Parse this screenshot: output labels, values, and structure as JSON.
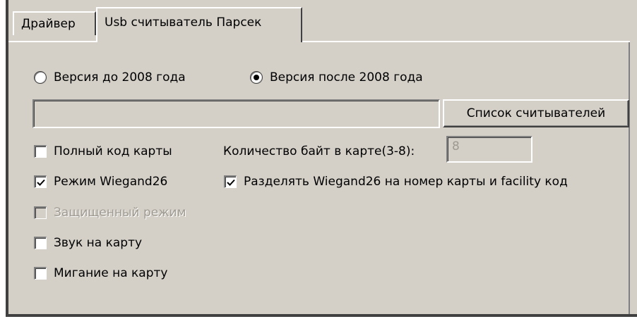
{
  "tabs": [
    {
      "label": "Драйвер",
      "active": false
    },
    {
      "label": "Usb считыватель Парсек",
      "active": true
    }
  ],
  "version": {
    "options": [
      {
        "label": "Версия до 2008 года",
        "selected": false
      },
      {
        "label": "Версия после 2008 года",
        "selected": true
      }
    ]
  },
  "reader": {
    "path_value": "",
    "list_button_label": "Список считывателей"
  },
  "options": {
    "full_code": {
      "label": "Полный код карты",
      "checked": false
    },
    "wiegand26": {
      "label": "Режим Wiegand26",
      "checked": true
    },
    "protected_mode": {
      "label": "Защищенный режим",
      "checked": false,
      "disabled": true
    },
    "sound": {
      "label": "Звук на карту",
      "checked": false
    },
    "blink": {
      "label": "Мигание на карту",
      "checked": false
    },
    "split_wiegand": {
      "label": "Разделять Wiegand26 на номер карты и facility код",
      "checked": true
    }
  },
  "bytes": {
    "label": "Количество байт в карте(3-8):",
    "value": "8",
    "disabled": true
  }
}
